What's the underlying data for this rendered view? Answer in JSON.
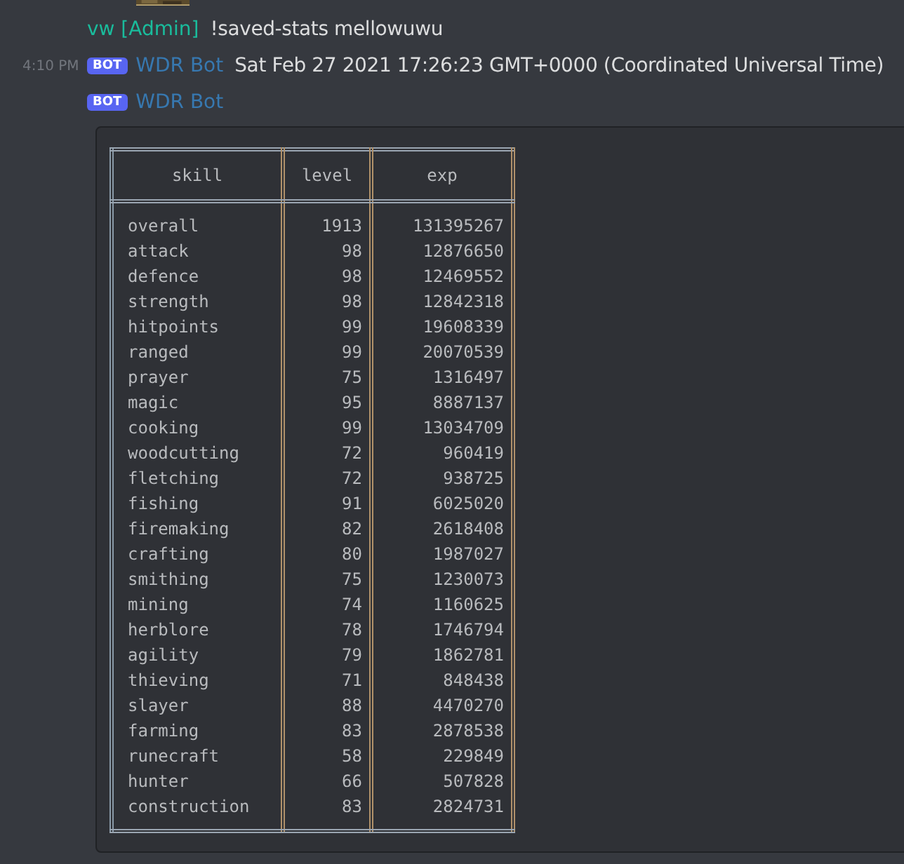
{
  "messages": [
    {
      "author": "vw [Admin]",
      "bot": false,
      "text": "!saved-stats mellowuwu"
    },
    {
      "author": "WDR Bot",
      "bot": true,
      "badge": "BOT",
      "timestamp": "4:10 PM",
      "text": "Sat Feb 27 2021 17:26:23 GMT+0000 (Coordinated Universal Time)"
    },
    {
      "author": "WDR Bot",
      "bot": true,
      "badge": "BOT"
    }
  ],
  "code_table": {
    "columns": [
      "skill",
      "level",
      "exp"
    ],
    "rows": [
      [
        "overall",
        "1913",
        "131395267"
      ],
      [
        "attack",
        "98",
        "12876650"
      ],
      [
        "defence",
        "98",
        "12469552"
      ],
      [
        "strength",
        "98",
        "12842318"
      ],
      [
        "hitpoints",
        "99",
        "19608339"
      ],
      [
        "ranged",
        "99",
        "20070539"
      ],
      [
        "prayer",
        "75",
        "1316497"
      ],
      [
        "magic",
        "95",
        "8887137"
      ],
      [
        "cooking",
        "99",
        "13034709"
      ],
      [
        "woodcutting",
        "72",
        "960419"
      ],
      [
        "fletching",
        "72",
        "938725"
      ],
      [
        "fishing",
        "91",
        "6025020"
      ],
      [
        "firemaking",
        "82",
        "2618408"
      ],
      [
        "crafting",
        "80",
        "1987027"
      ],
      [
        "smithing",
        "75",
        "1230073"
      ],
      [
        "mining",
        "74",
        "1160625"
      ],
      [
        "herblore",
        "78",
        "1746794"
      ],
      [
        "agility",
        "79",
        "1862781"
      ],
      [
        "thieving",
        "71",
        "848438"
      ],
      [
        "slayer",
        "88",
        "4470270"
      ],
      [
        "farming",
        "83",
        "2878538"
      ],
      [
        "runecraft",
        "58",
        "229849"
      ],
      [
        "hunter",
        "66",
        "507828"
      ],
      [
        "construction",
        "83",
        "2824731"
      ]
    ]
  }
}
